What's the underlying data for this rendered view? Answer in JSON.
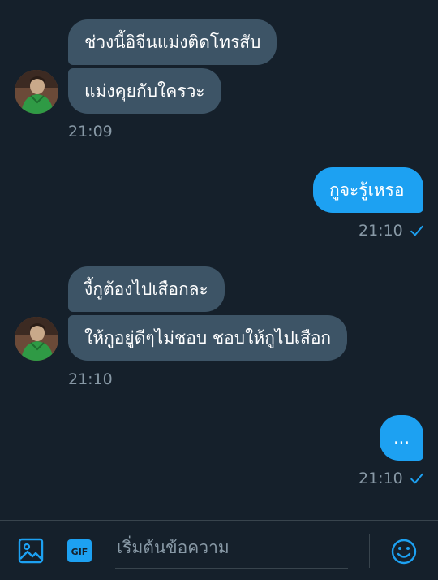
{
  "colors": {
    "background": "#15202b",
    "incoming_bubble": "#3d5466",
    "outgoing_bubble": "#1da1f2",
    "accent": "#1da1f2",
    "muted_text": "#8899a6"
  },
  "messages": {
    "group1": {
      "bubble1": "ช่วงนี้อิจีนแม่งติดโทรสับ",
      "bubble2": "แม่งคุยกับใครวะ",
      "time": "21:09"
    },
    "out1": {
      "text": "กูจะรู้เหรอ",
      "time": "21:10",
      "status_icon": "check-icon"
    },
    "group2": {
      "bubble1": "งี้กูต้องไปเสือกละ",
      "bubble2": "ให้กูอยู่ดีๆไม่ชอบ ชอบให้กูไปเสือก",
      "time": "21:10"
    },
    "out2": {
      "text": "...",
      "time": "21:10",
      "status_icon": "check-icon"
    }
  },
  "composer": {
    "placeholder": "เริ่มต้นข้อความ",
    "icons": [
      "image-icon",
      "gif-icon",
      "emoji-icon"
    ]
  }
}
